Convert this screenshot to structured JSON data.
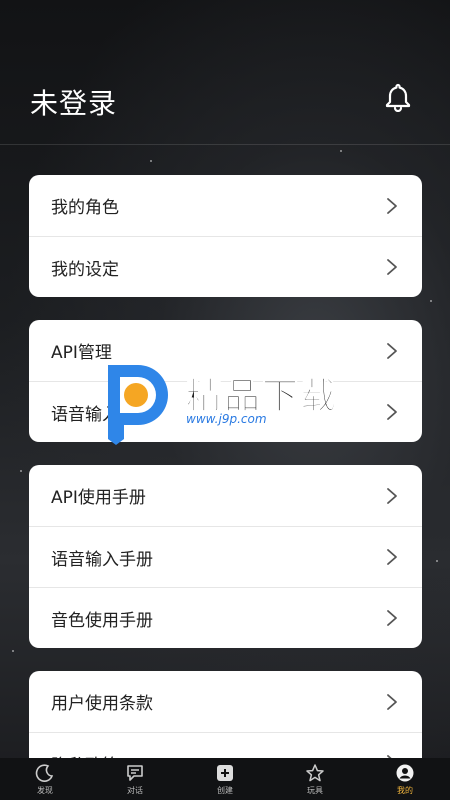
{
  "header": {
    "title": "未登录"
  },
  "cards": [
    {
      "items": [
        {
          "label": "我的角色"
        },
        {
          "label": "我的设定"
        }
      ]
    },
    {
      "items": [
        {
          "label": "API管理"
        },
        {
          "label": "语音输入配置"
        }
      ]
    },
    {
      "items": [
        {
          "label": "API使用手册"
        },
        {
          "label": "语音输入手册"
        },
        {
          "label": "音色使用手册"
        }
      ]
    },
    {
      "items": [
        {
          "label": "用户使用条款"
        },
        {
          "label": "隐私政策"
        }
      ]
    }
  ],
  "watermark": {
    "title": "精品下载",
    "url": "www.j9p.com"
  },
  "tabbar": {
    "tabs": [
      {
        "label": "发现",
        "icon": "moon-icon"
      },
      {
        "label": "对话",
        "icon": "chat-icon"
      },
      {
        "label": "创建",
        "icon": "plus-square-icon"
      },
      {
        "label": "玩具",
        "icon": "star-icon"
      },
      {
        "label": "我的",
        "icon": "user-icon",
        "active": true
      }
    ]
  },
  "colors": {
    "accent": "#f0b43c",
    "card": "#ffffff",
    "background": "#1f2124"
  }
}
